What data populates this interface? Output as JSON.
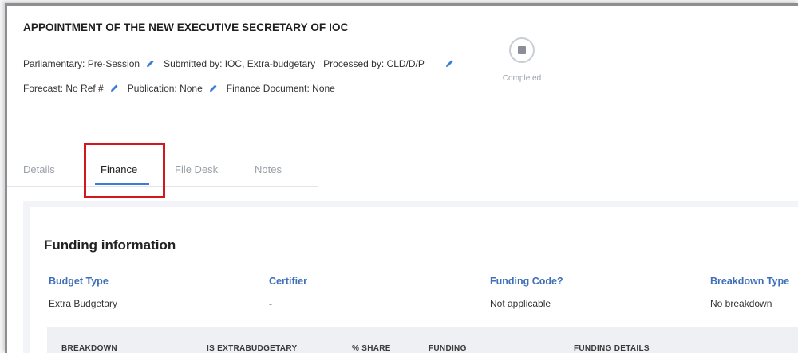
{
  "header": {
    "title": "APPOINTMENT OF THE NEW EXECUTIVE SECRETARY OF IOC",
    "row1": {
      "parliamentary": "Parliamentary: Pre-Session",
      "submitted_by": "Submitted by: IOC, Extra-budgetary",
      "processed_by": "Processed by: CLD/D/P"
    },
    "row2": {
      "forecast": "Forecast: No Ref #",
      "publication": "Publication: None",
      "finance_document": "Finance Document: None"
    },
    "status": {
      "label": "Completed",
      "icon": "stop-square-icon"
    }
  },
  "tabs": [
    {
      "label": "Details",
      "active": false
    },
    {
      "label": "Finance",
      "active": true
    },
    {
      "label": "File Desk",
      "active": false
    },
    {
      "label": "Notes",
      "active": false
    }
  ],
  "funding": {
    "title": "Funding information",
    "fields": [
      {
        "label": "Budget Type",
        "value": "Extra Budgetary"
      },
      {
        "label": "Certifier",
        "value": "-"
      },
      {
        "label": "Funding Code?",
        "value": "Not applicable"
      },
      {
        "label": "Breakdown Type",
        "value": "No breakdown"
      }
    ],
    "table_headers": [
      "BREAKDOWN",
      "IS EXTRABUDGETARY",
      "% SHARE",
      "FUNDING",
      "FUNDING DETAILS"
    ]
  },
  "colors": {
    "accent": "#3d7bd9",
    "label_blue": "#3f6fb8",
    "highlight": "#d0191f"
  }
}
